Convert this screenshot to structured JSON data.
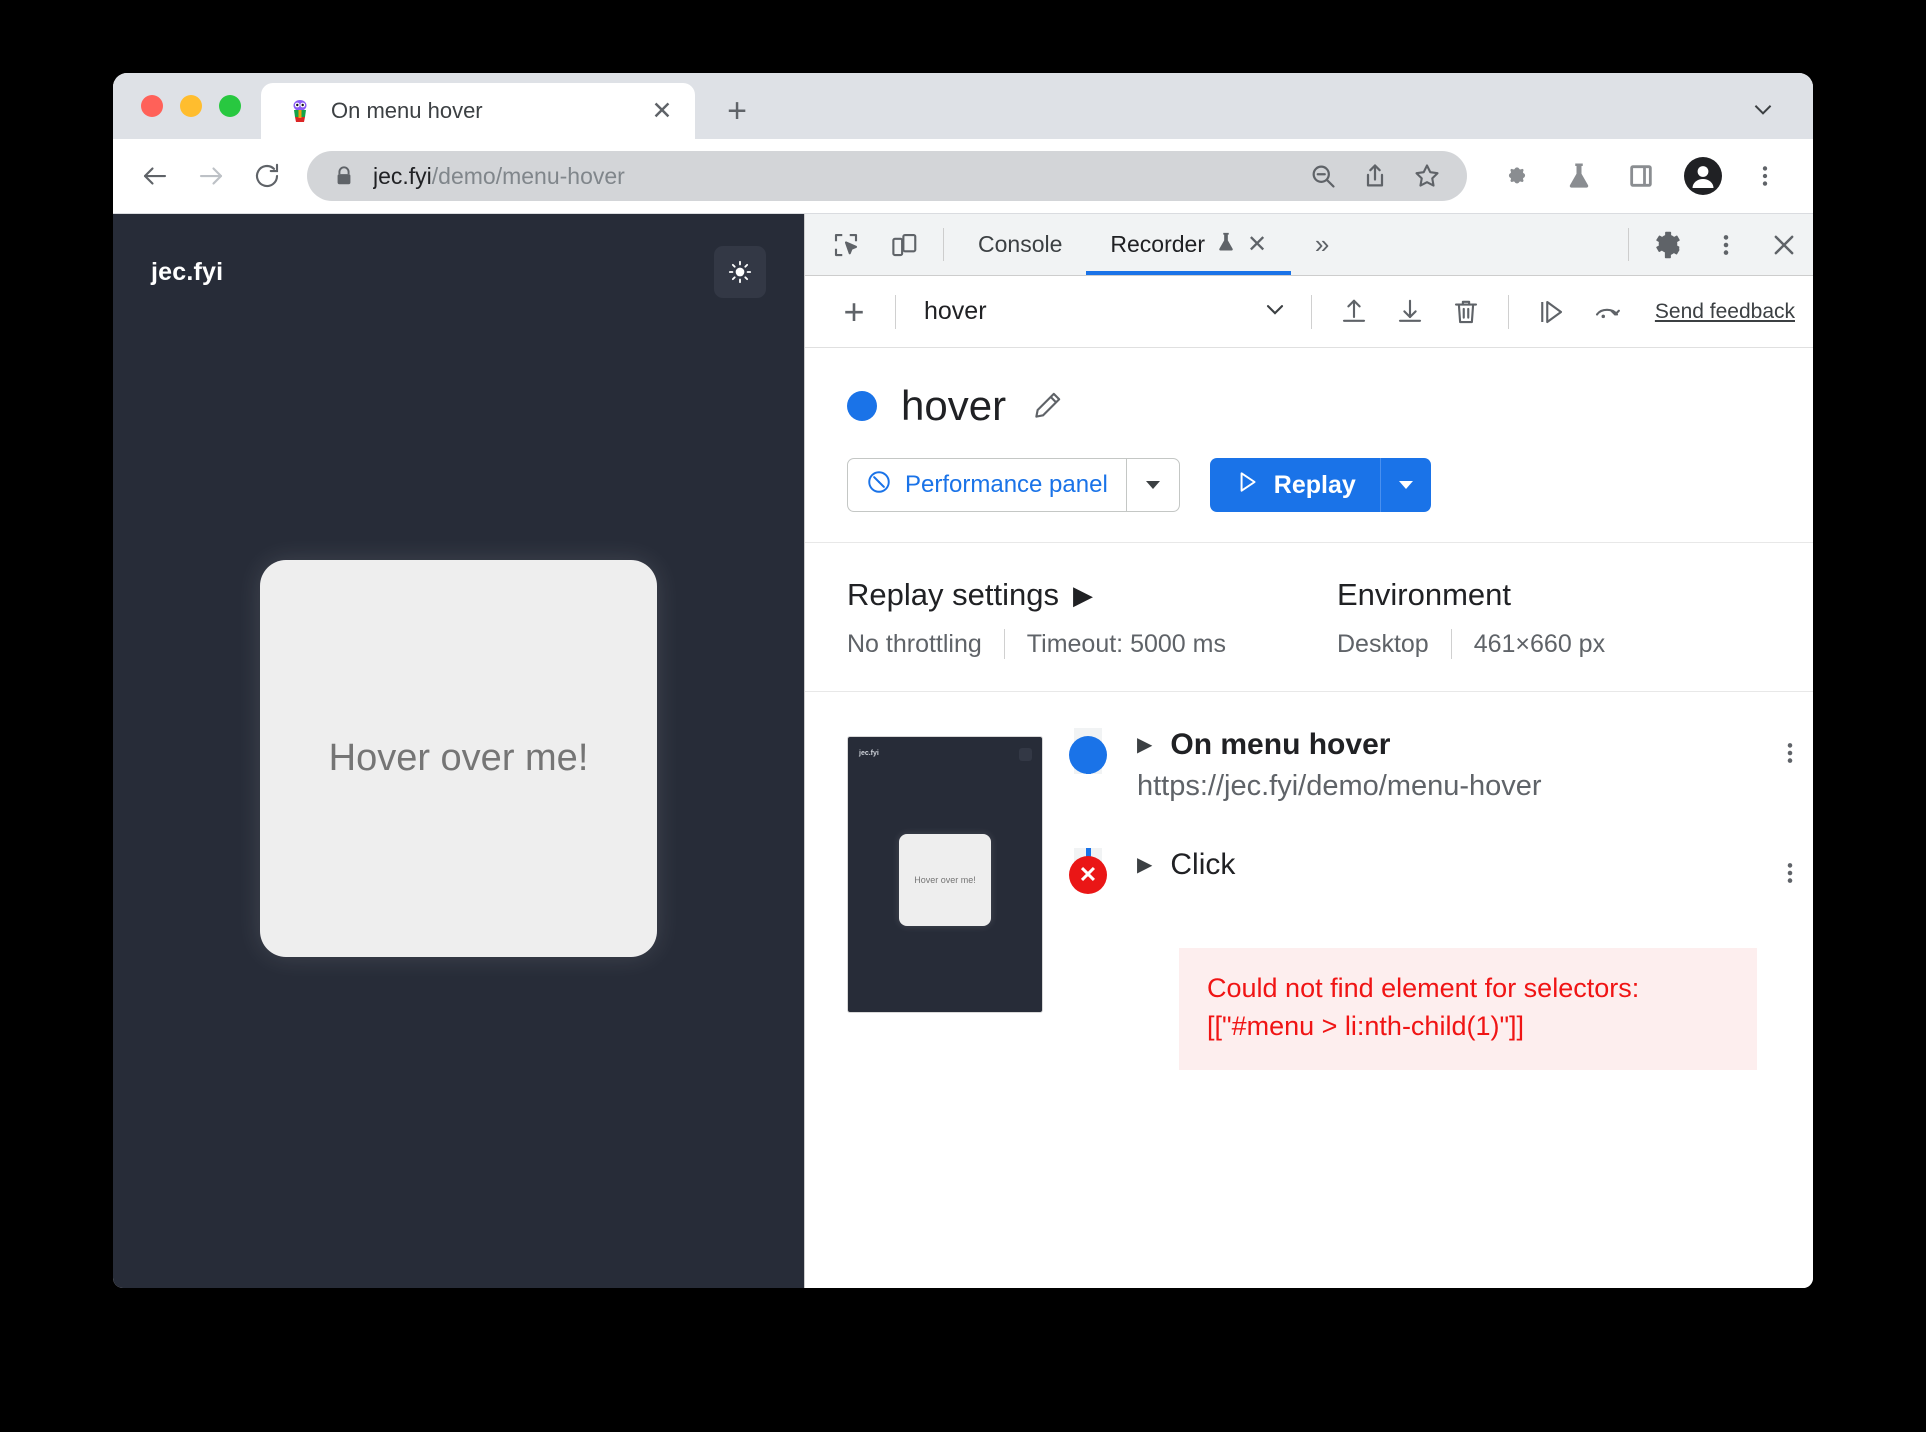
{
  "window": {
    "traffic_lights": [
      "close",
      "minimize",
      "maximize"
    ]
  },
  "tabstrip": {
    "tab_title": "On menu hover",
    "favicon": "avatar-favicon",
    "close_label": "✕",
    "new_tab_label": "+",
    "window_chevron": "chevron-down-icon"
  },
  "toolbar": {
    "back": "back-arrow-icon",
    "forward": "forward-arrow-icon",
    "reload": "reload-icon",
    "lock": "lock-icon",
    "url_host": "jec.fyi",
    "url_path": "/demo/menu-hover",
    "full_url": "jec.fyi/demo/menu-hover",
    "omnibox_actions": [
      "zoom-out-icon",
      "share-icon",
      "bookmark-star-icon"
    ],
    "right_icons": [
      "extensions-puzzle-icon",
      "lab-flask-icon",
      "side-panel-icon",
      "profile-avatar-icon",
      "browser-menu-icon"
    ]
  },
  "page": {
    "logo": "jec.fyi",
    "theme_toggle": "sun-icon",
    "card_label": "Hover over me!"
  },
  "devtools": {
    "tabbar": {
      "inspect_icon": "inspect-element-icon",
      "device_icon": "device-toolbar-icon",
      "tabs": [
        {
          "label": "Console",
          "active": false,
          "closable": false
        },
        {
          "label": "Recorder",
          "active": true,
          "closable": true,
          "badge": "lab-flask-icon",
          "close": "✕"
        }
      ],
      "more_tabs": "»",
      "settings_icon": "gear-icon",
      "more_icon": "kebab-menu-icon",
      "close_icon": "close-icon"
    },
    "recorder_toolbar": {
      "add_label": "+",
      "selected_recording": "hover",
      "dropdown_icon": "chevron-down-icon",
      "export_icon": "export-upload-icon",
      "import_icon": "import-download-icon",
      "delete_icon": "trash-icon",
      "step_icon": "step-replay-icon",
      "rerecord_icon": "replay-undo-icon",
      "feedback_label": "Send feedback"
    },
    "recording": {
      "title": "hover",
      "status_dot_color": "#1a73e8",
      "edit_icon": "pencil-edit-icon",
      "performance_button": {
        "label": "Performance panel",
        "icon": "performance-panel-icon",
        "arrow": "chevron-down-icon"
      },
      "replay_button": {
        "label": "Replay",
        "icon": "play-triangle-icon",
        "arrow": "chevron-down-icon"
      }
    },
    "settings": {
      "replay": {
        "heading": "Replay settings",
        "caret": "▶",
        "throttling": "No throttling",
        "timeout": "Timeout: 5000 ms"
      },
      "environment": {
        "heading": "Environment",
        "device": "Desktop",
        "viewport": "461×660 px"
      }
    },
    "steps": {
      "thumbnail": {
        "logo": "jec.fyi",
        "card_label": "Hover over me!",
        "toggle": "sun-icon"
      },
      "items": [
        {
          "marker": "success",
          "caret": "▶",
          "name": "On menu hover",
          "url": "https://jec.fyi/demo/menu-hover",
          "menu_icon": "kebab-menu-icon"
        },
        {
          "marker": "error",
          "marker_glyph": "✕",
          "caret": "▶",
          "name": "Click",
          "url": "",
          "menu_icon": "kebab-menu-icon"
        }
      ],
      "error": {
        "line1": "Could not find element for selectors:",
        "line2": "[[\"#menu > li:nth-child(1)\"]]",
        "color": "#f01414",
        "background": "#fdeeee"
      }
    }
  }
}
